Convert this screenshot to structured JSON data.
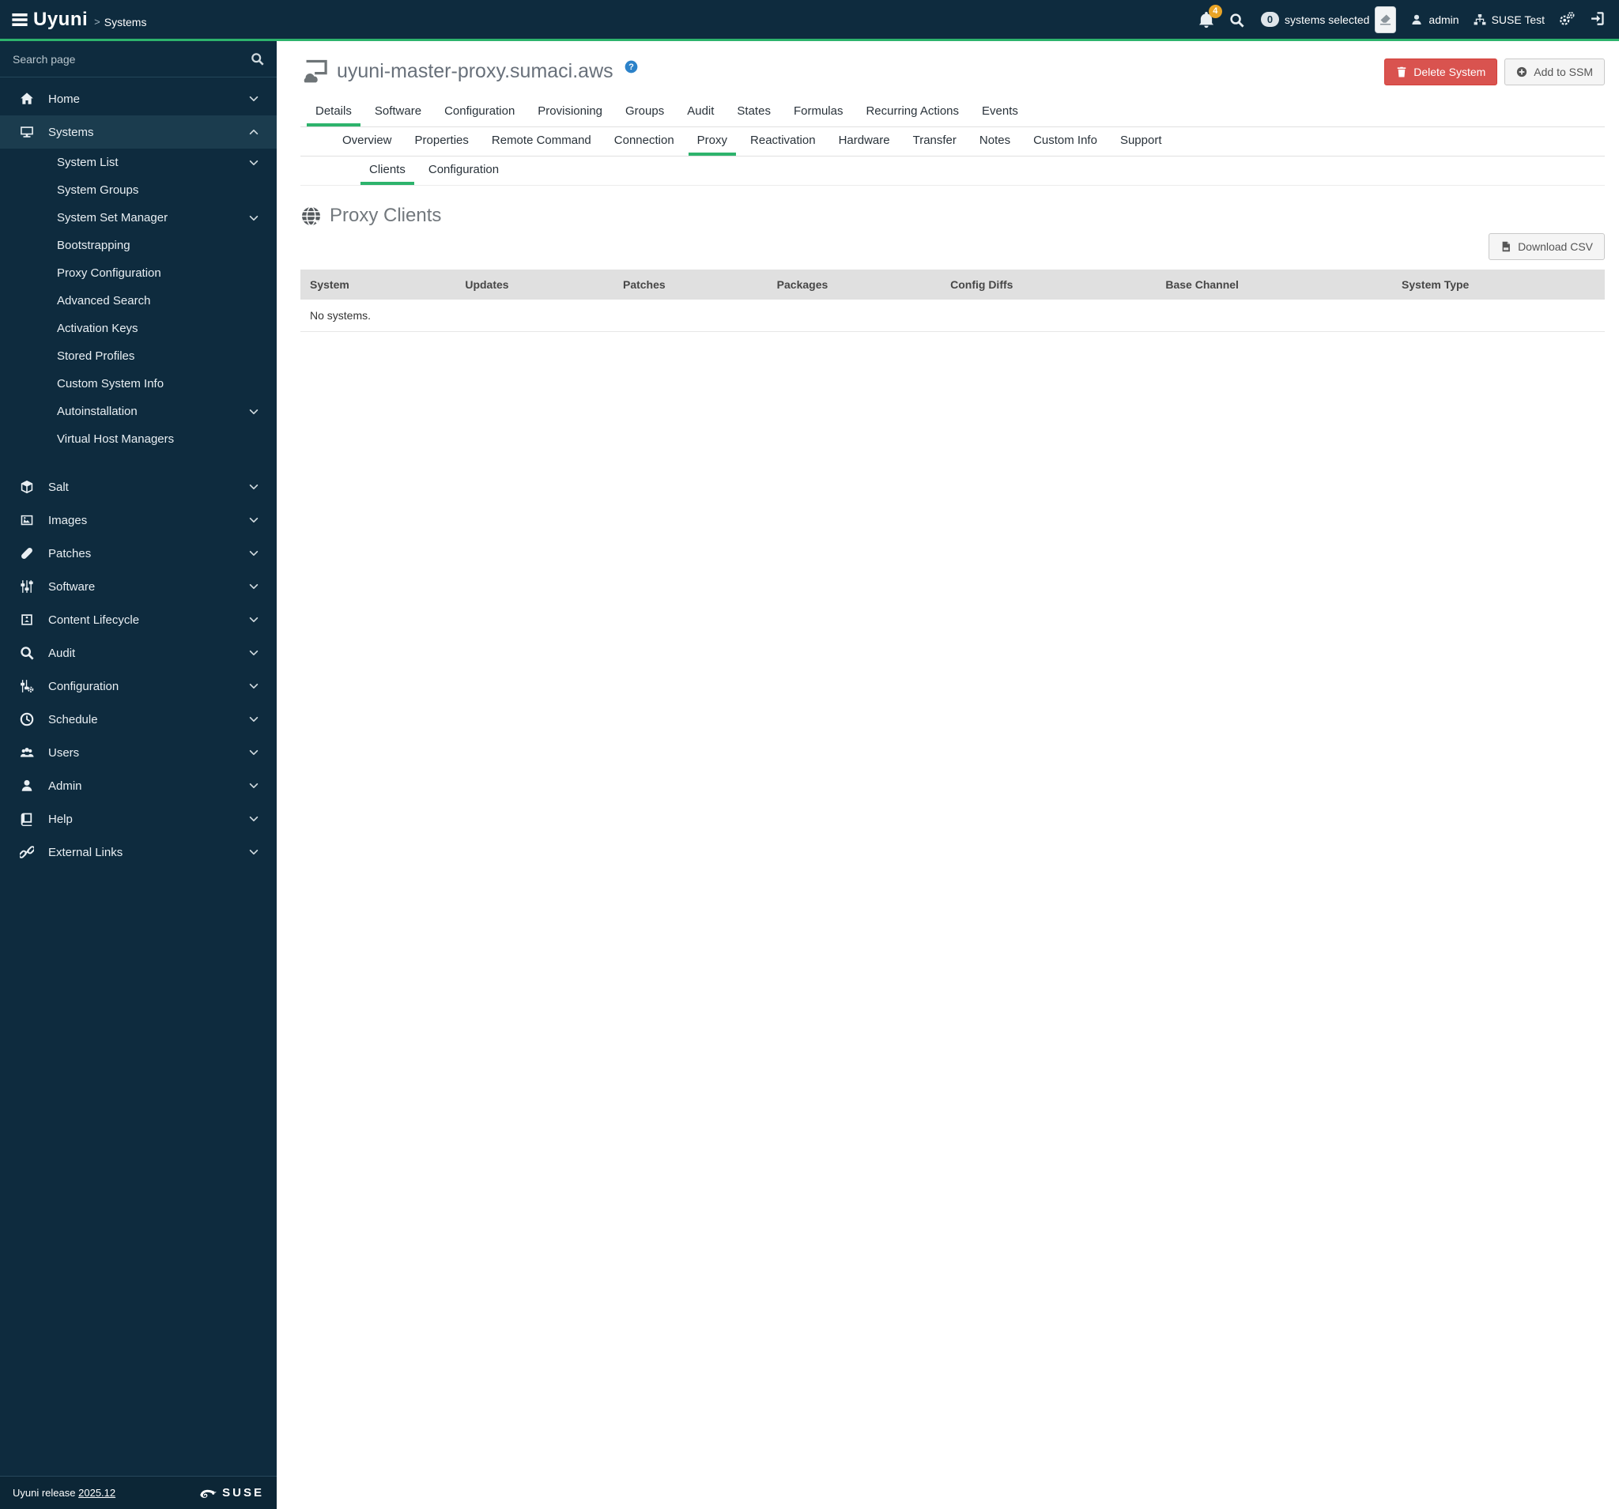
{
  "topbar": {
    "brand": "Uyuni",
    "breadcrumb_sep": ">",
    "breadcrumb": "Systems",
    "notification_count": "4",
    "ssm_count": "0",
    "ssm_label": "systems selected",
    "user": "admin",
    "org": "SUSE Test"
  },
  "sidebar": {
    "search_placeholder": "Search page",
    "items": [
      {
        "label": "Home"
      },
      {
        "label": "Systems"
      },
      {
        "label": "System List"
      },
      {
        "label": "System Groups"
      },
      {
        "label": "System Set Manager"
      },
      {
        "label": "Bootstrapping"
      },
      {
        "label": "Proxy Configuration"
      },
      {
        "label": "Advanced Search"
      },
      {
        "label": "Activation Keys"
      },
      {
        "label": "Stored Profiles"
      },
      {
        "label": "Custom System Info"
      },
      {
        "label": "Autoinstallation"
      },
      {
        "label": "Virtual Host Managers"
      },
      {
        "label": "Salt"
      },
      {
        "label": "Images"
      },
      {
        "label": "Patches"
      },
      {
        "label": "Software"
      },
      {
        "label": "Content Lifecycle"
      },
      {
        "label": "Audit"
      },
      {
        "label": "Configuration"
      },
      {
        "label": "Schedule"
      },
      {
        "label": "Users"
      },
      {
        "label": "Admin"
      },
      {
        "label": "Help"
      },
      {
        "label": "External Links"
      }
    ],
    "footer": {
      "release_prefix": "Uyuni release",
      "release_version": "2025.12",
      "brand": "SUSE"
    }
  },
  "main": {
    "title": "uyuni-master-proxy.sumaci.aws",
    "actions": {
      "delete_label": "Delete System",
      "add_ssm_label": "Add to SSM"
    },
    "tabs_level1": [
      {
        "label": "Details",
        "active": true
      },
      {
        "label": "Software"
      },
      {
        "label": "Configuration"
      },
      {
        "label": "Provisioning"
      },
      {
        "label": "Groups"
      },
      {
        "label": "Audit"
      },
      {
        "label": "States"
      },
      {
        "label": "Formulas"
      },
      {
        "label": "Recurring Actions"
      },
      {
        "label": "Events"
      }
    ],
    "tabs_level2": [
      {
        "label": "Overview"
      },
      {
        "label": "Properties"
      },
      {
        "label": "Remote Command"
      },
      {
        "label": "Connection"
      },
      {
        "label": "Proxy",
        "active": true
      },
      {
        "label": "Reactivation"
      },
      {
        "label": "Hardware"
      },
      {
        "label": "Transfer"
      },
      {
        "label": "Notes"
      },
      {
        "label": "Custom Info"
      },
      {
        "label": "Support"
      }
    ],
    "tabs_level3": [
      {
        "label": "Clients",
        "active": true
      },
      {
        "label": "Configuration"
      }
    ],
    "section_title": "Proxy Clients",
    "toolbar": {
      "download_csv_label": "Download CSV"
    },
    "table": {
      "columns": [
        "System",
        "Updates",
        "Patches",
        "Packages",
        "Config Diffs",
        "Base Channel",
        "System Type"
      ],
      "empty_text": "No systems."
    },
    "colors": {
      "accent_green": "#2db36c",
      "navbar_bg": "#0e2b3e",
      "danger_red": "#d9534f",
      "badge_orange": "#e9a426"
    }
  }
}
